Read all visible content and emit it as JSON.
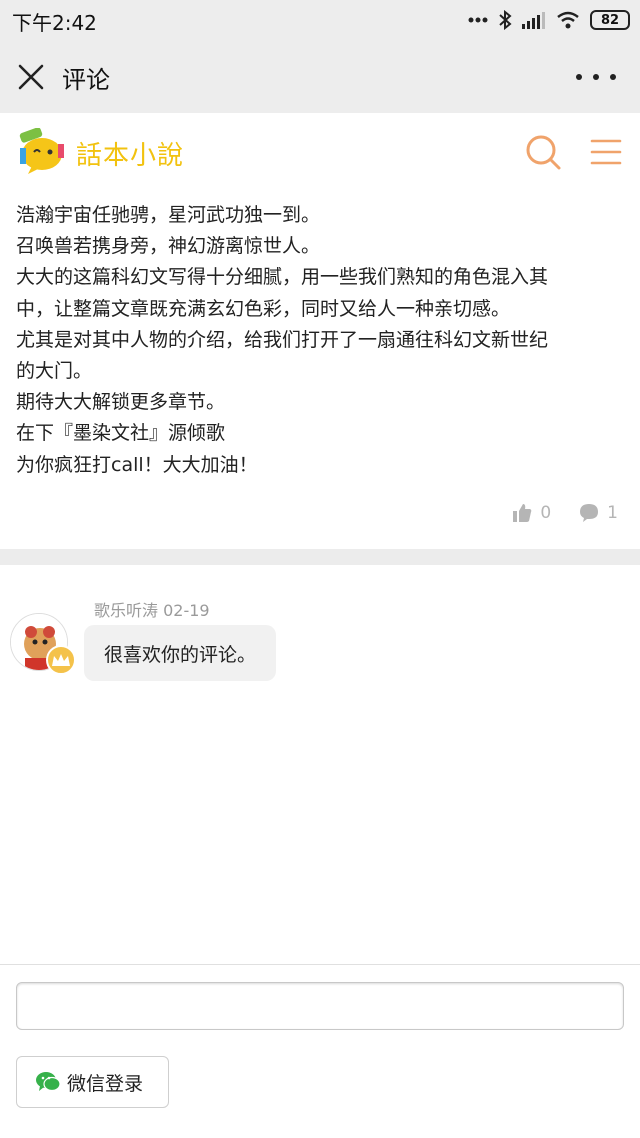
{
  "status_bar": {
    "time": "下午2:42",
    "battery": "82"
  },
  "header": {
    "title": "评论"
  },
  "site": {
    "logo_text": "話本小說"
  },
  "comment": {
    "lines": [
      "浩瀚宇宙任驰骋，星河武功独一到。",
      "召唤兽若携身旁，神幻游离惊世人。",
      "大大的这篇科幻文写得十分细腻，用一些我们熟知的角色混入其",
      "中，让整篇文章既充满玄幻色彩，同时又给人一种亲切感。",
      "尤其是对其中人物的介绍，给我们打开了一扇通往科幻文新世纪",
      "的大门。",
      "期待大大解锁更多章节。",
      "在下『墨染文社』源倾歌",
      "为你疯狂打call！大大加油！"
    ],
    "like_count": "0",
    "reply_count": "1"
  },
  "reply": {
    "meta": "歌乐听涛 02-19",
    "text": "很喜欢你的评论。"
  },
  "bottom": {
    "input_value": "",
    "wechat_login_label": "微信登录"
  },
  "colors": {
    "accent": "#f0a36b",
    "logo_yellow": "#f2c20f",
    "wechat_green": "#36b14a"
  }
}
